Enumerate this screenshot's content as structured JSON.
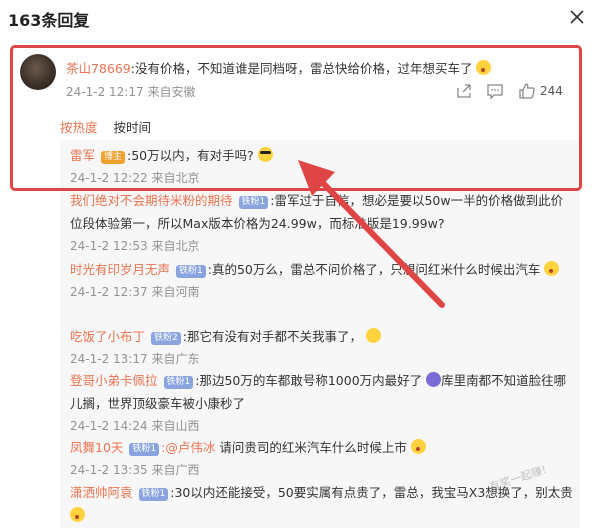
{
  "header": {
    "title": "163条回复"
  },
  "main": {
    "username": "茶山78669",
    "text": ":没有价格，不知道谁是同档呀，雷总快给价格，过年想买车了",
    "time": "24-1-2 12:17",
    "location": "来自安徽",
    "likes": "244"
  },
  "sort": {
    "hot": "按热度",
    "time": "按时间"
  },
  "replies": [
    {
      "user": "雷军",
      "badge": "博主",
      "text": ":50万以内，有对手吗?",
      "time": "24-1-2 12:22",
      "location": "来自北京"
    },
    {
      "user": "我们绝对不会期待米粉的期待",
      "badge": "铁粉1",
      "text": ":雷军过于自信，想必是要以50w一半的价格做到此价位段体验第一，所以Max版本价格为24.99w，而标准版是19.99w?",
      "time": "24-1-2 12:53",
      "location": "来自北京"
    },
    {
      "user": "时光有印岁月无声",
      "badge": "铁粉1",
      "text": ":真的50万么，雷总不问价格了，只想问红米什么时候出汽车",
      "time": "24-1-2 12:37",
      "location": "来自河南"
    },
    {
      "user": "吃饭了小布丁",
      "badge": "铁粉2",
      "text": ":那它有没有对手都不关我事了，",
      "time": "24-1-2 13:17",
      "location": "来自广东"
    },
    {
      "user": "登哥小弟卡佩拉",
      "badge": "铁粉1",
      "text": ":那边50万的车都敢号称1000万内最好了",
      "text2": "库里南都不知道脸往哪儿搁，世界顶级豪车被小康秒了",
      "time": "24-1-2 14:24",
      "location": "来自山西"
    },
    {
      "user": "凤舞10天",
      "badge": "铁粉1",
      "mention": ":@卢伟冰",
      "text": " 请问贵司的红米汽车什么时候上市",
      "time": "24-1-2 13:35",
      "location": "来自广西"
    },
    {
      "user": "潇洒帅阿袁",
      "badge": "铁粉1",
      "text": ":30以内还能接受，50要实属有点贵了，雷总，我宝马X3想换了，别太贵"
    }
  ],
  "watermark": "有奖一起赚!",
  "colors": {
    "username": "#eb7350",
    "highlight": "#e04545",
    "meta": "#939393"
  },
  "icons": [
    "close-icon",
    "share-icon",
    "comment-icon",
    "like-icon"
  ]
}
